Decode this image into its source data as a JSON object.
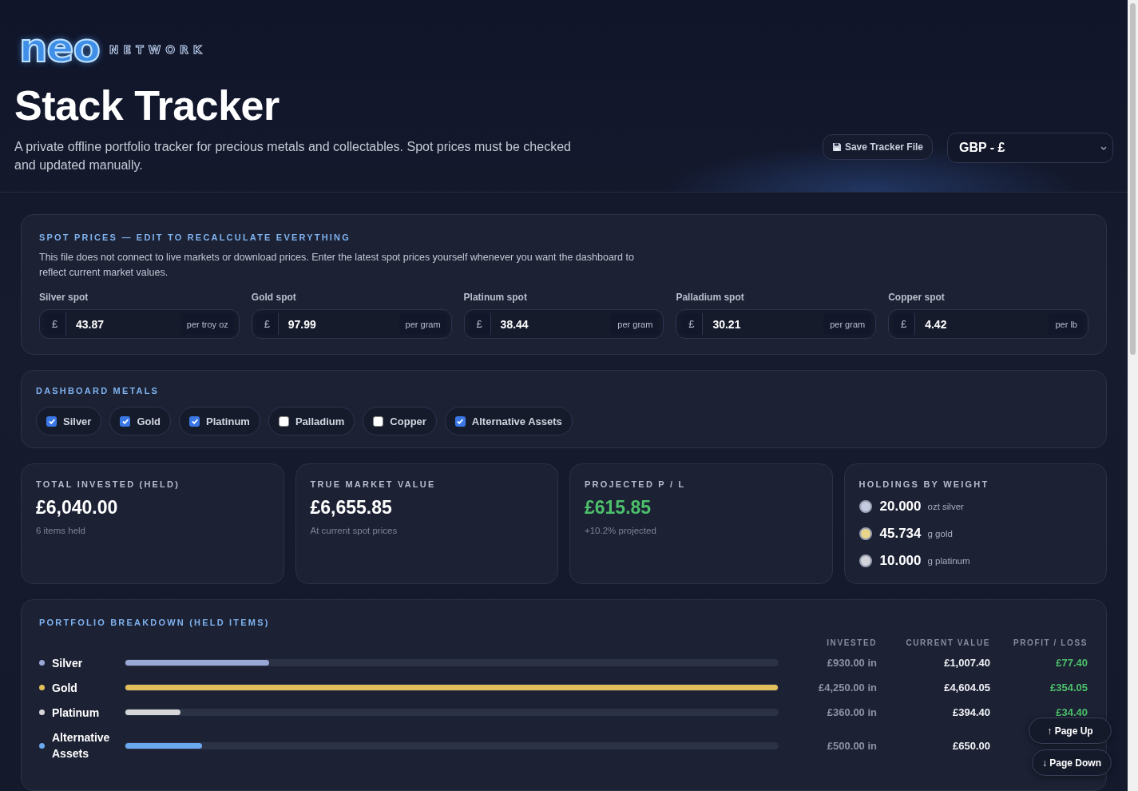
{
  "brand": {
    "logo": "neo",
    "wordmark": "NETWORK"
  },
  "header": {
    "title": "Stack Tracker",
    "subtitle": "A private offline portfolio tracker for precious metals and collectables. Spot prices must be checked and updated manually.",
    "save_button": "Save Tracker File",
    "currency": "GBP - £"
  },
  "spot_prices": {
    "heading": "SPOT PRICES — EDIT TO RECALCULATE EVERYTHING",
    "note": "This file does not connect to live markets or download prices. Enter the latest spot prices yourself whenever you want the dashboard to reflect current market values.",
    "fields": [
      {
        "label": "Silver spot",
        "prefix": "£",
        "value": "43.87",
        "unit": "per troy oz"
      },
      {
        "label": "Gold spot",
        "prefix": "£",
        "value": "97.99",
        "unit": "per gram"
      },
      {
        "label": "Platinum spot",
        "prefix": "£",
        "value": "38.44",
        "unit": "per gram"
      },
      {
        "label": "Palladium spot",
        "prefix": "£",
        "value": "30.21",
        "unit": "per gram"
      },
      {
        "label": "Copper spot",
        "prefix": "£",
        "value": "4.42",
        "unit": "per lb"
      }
    ]
  },
  "dashboard_metals": {
    "heading": "DASHBOARD METALS",
    "options": [
      {
        "label": "Silver",
        "checked": true
      },
      {
        "label": "Gold",
        "checked": true
      },
      {
        "label": "Platinum",
        "checked": true
      },
      {
        "label": "Palladium",
        "checked": false
      },
      {
        "label": "Copper",
        "checked": false
      },
      {
        "label": "Alternative Assets",
        "checked": true
      }
    ]
  },
  "stats": [
    {
      "title": "TOTAL INVESTED (HELD)",
      "value": "£6,040.00",
      "note": "6 items held",
      "kind": "neutral"
    },
    {
      "title": "TRUE MARKET VALUE",
      "value": "£6,655.85",
      "note": "At current spot prices",
      "kind": "neutral"
    },
    {
      "title": "PROJECTED P / L",
      "value": "£615.85",
      "note": "+10.2% projected",
      "kind": "positive"
    }
  ],
  "holdings": {
    "heading": "HOLDINGS BY WEIGHT",
    "items": [
      {
        "amount": "20.000",
        "unit": "ozt silver",
        "color": "#c5cbe0"
      },
      {
        "amount": "45.734",
        "unit": "g gold",
        "color": "#e8d48a"
      },
      {
        "amount": "10.000",
        "unit": "g platinum",
        "color": "#d2d4da"
      }
    ]
  },
  "breakdown": {
    "heading": "PORTFOLIO BREAKDOWN (HELD ITEMS)",
    "columns": [
      "INVESTED",
      "CURRENT VALUE",
      "PROFIT / LOSS"
    ],
    "rows": [
      {
        "name": "Silver",
        "color": "#9aa8d8",
        "level": 0.22,
        "invested": "£930.00 in",
        "current": "£1,007.40",
        "profit": "£77.40"
      },
      {
        "name": "Gold",
        "color": "#e2bf5a",
        "level": 1.0,
        "invested": "£4,250.00 in",
        "current": "£4,604.05",
        "profit": "£354.05"
      },
      {
        "name": "Platinum",
        "color": "#d6d6d8",
        "level": 0.085,
        "invested": "£360.00 in",
        "current": "£394.40",
        "profit": "£34.40"
      },
      {
        "name": "Alternative Assets",
        "color": "#6aa9ee",
        "level": 0.118,
        "invested": "£500.00 in",
        "current": "£650.00"
      }
    ]
  },
  "page_nav": [
    {
      "label": "↑ Page Up"
    },
    {
      "label": "↓ Page Down"
    }
  ]
}
